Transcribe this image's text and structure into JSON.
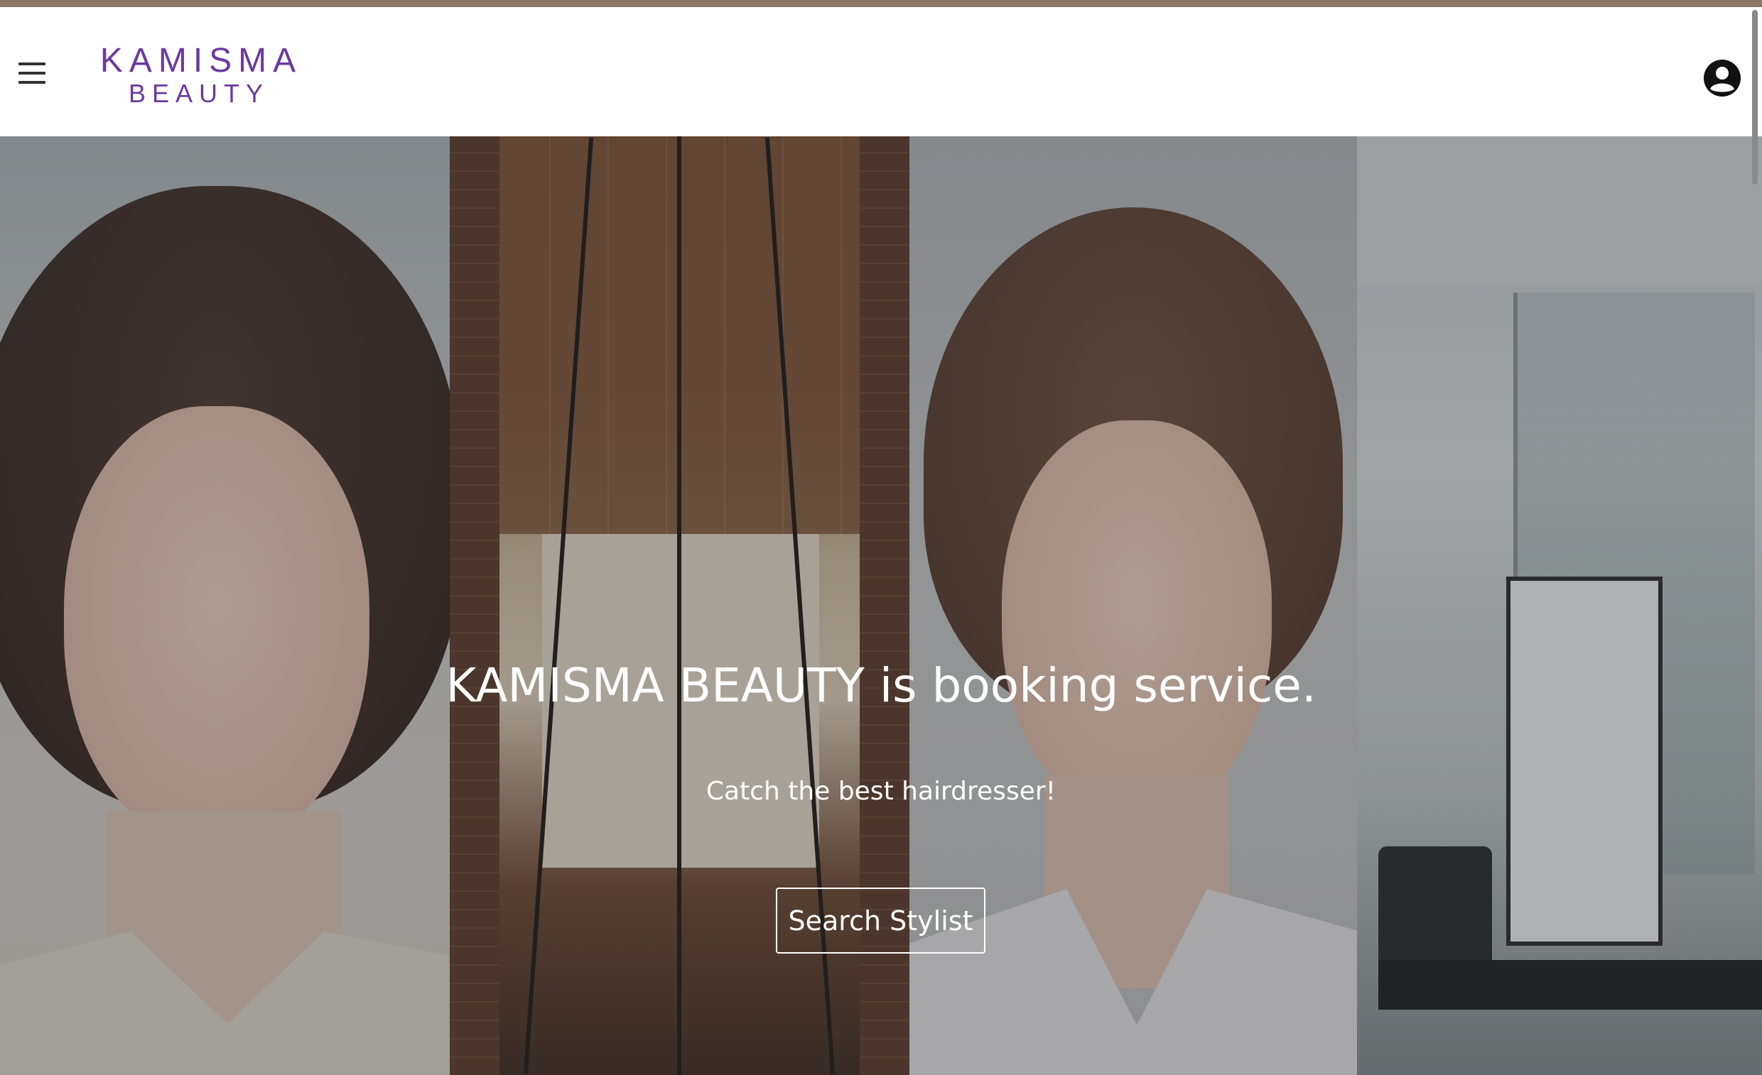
{
  "app": {
    "brand_line1": "KAMISMA",
    "brand_line2": "BEAUTY",
    "accent_color": "#6a3aa0",
    "top_strip_color": "#8c7767"
  },
  "header": {
    "menu_icon": "hamburger-menu-icon",
    "account_icon": "account-circle-icon"
  },
  "hero": {
    "title": "KAMISMA BEAUTY is booking service.",
    "subtitle": "Catch the best hairdresser!",
    "cta_label": "Search Stylist"
  }
}
